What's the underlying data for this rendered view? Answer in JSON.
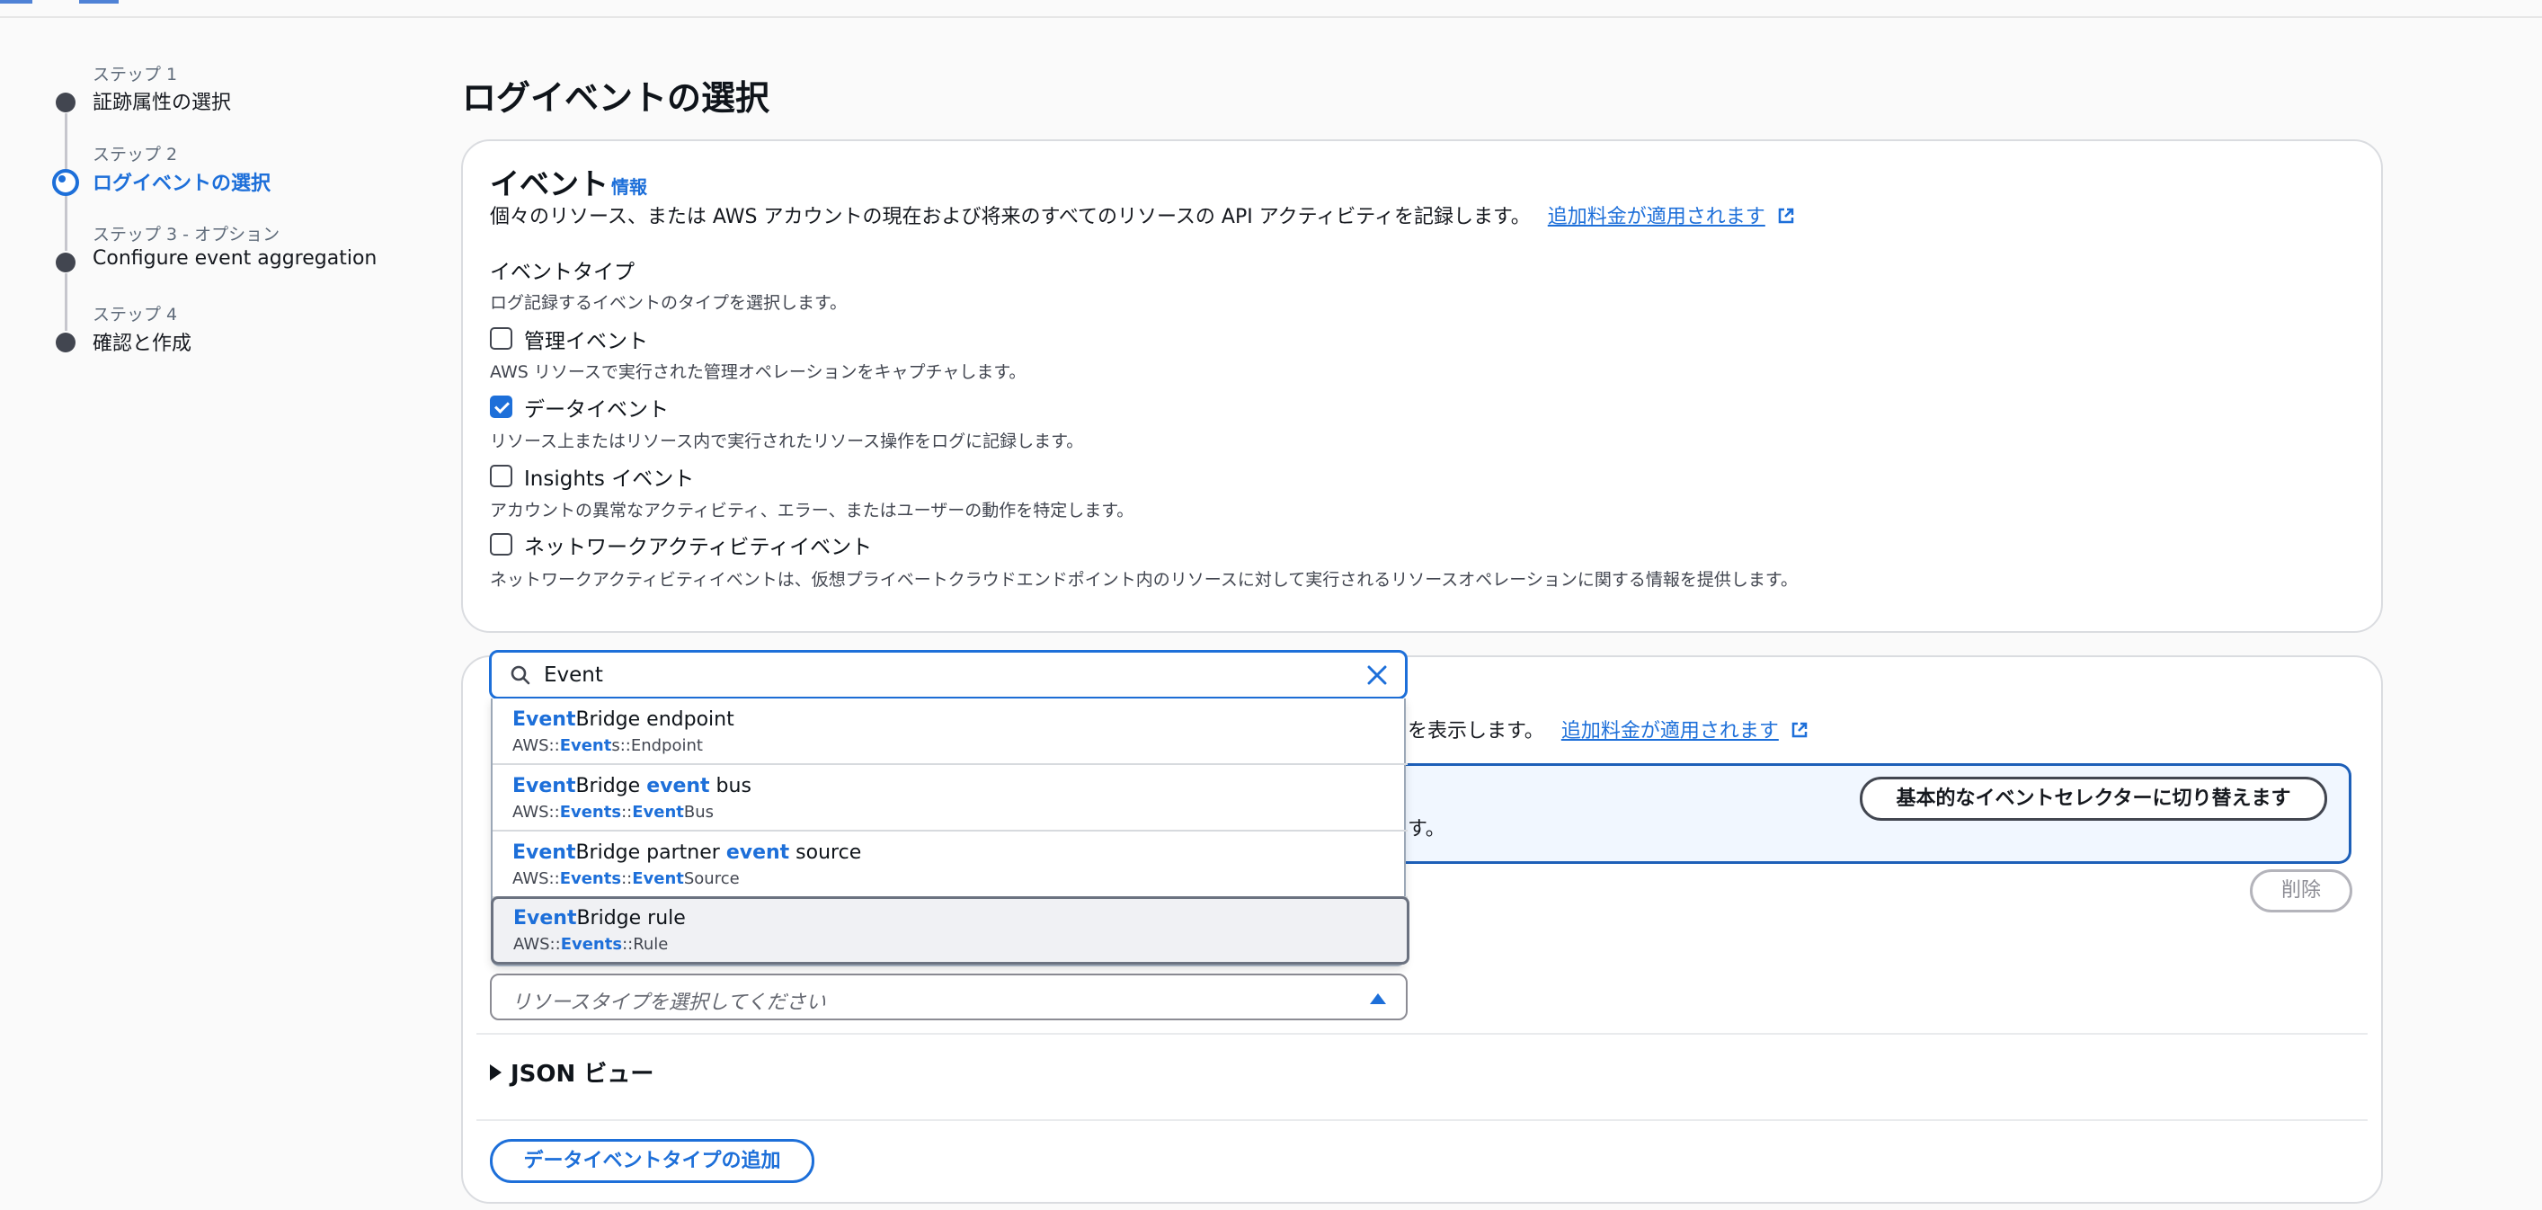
{
  "steps": [
    {
      "num": "ステップ 1",
      "title": "証跡属性の選択"
    },
    {
      "num": "ステップ 2",
      "title": "ログイベントの選択"
    },
    {
      "num": "ステップ 3 - オプション",
      "title": "Configure event aggregation"
    },
    {
      "num": "ステップ 4",
      "title": "確認と作成"
    }
  ],
  "active_step": 2,
  "page_title": "ログイベントの選択",
  "events_panel": {
    "heading": "イベント",
    "info_link": "情報",
    "description": "個々のリソース、または AWS アカウントの現在および将来のすべてのリソースの API アクティビティを記録します。",
    "pricing_link": "追加料金が適用されます",
    "event_type_label": "イベントタイプ",
    "event_type_hint": "ログ記録するイベントのタイプを選択します。",
    "options": [
      {
        "label": "管理イベント",
        "hint": "AWS リソースで実行された管理オペレーションをキャプチャします。",
        "checked": false
      },
      {
        "label": "データイベント",
        "hint": "リソース上またはリソース内で実行されたリソース操作をログに記録します。",
        "checked": true
      },
      {
        "label": "Insights イベント",
        "hint": "アカウントの異常なアクティビティ、エラー、またはユーザーの動作を特定します。",
        "checked": false
      },
      {
        "label": "ネットワークアクティビティイベント",
        "hint": "ネットワークアクティビティイベントは、仮想プライベートクラウドエンドポイント内のリソースに対して実行されるリソースオペレーションに関する情報を提供します。",
        "checked": false
      }
    ]
  },
  "data_events_panel": {
    "partial_description": "を表示します。",
    "pricing_link": "追加料金が適用されます",
    "info_partial": "す。",
    "switch_button": "基本的なイベントセレクターに切り替えます",
    "delete_button": "削除",
    "resource_type_placeholder": "リソースタイプを選択してください",
    "json_view": "JSON ビュー",
    "add_button": "データイベントタイプの追加"
  },
  "search": {
    "value": "Event",
    "results": [
      {
        "title_parts": [
          [
            "Event",
            true
          ],
          [
            "Bridge endpoint",
            false
          ]
        ],
        "sub_parts": [
          [
            "AWS::",
            false
          ],
          [
            "Event",
            true
          ],
          [
            "s::Endpoint",
            false
          ]
        ]
      },
      {
        "title_parts": [
          [
            "Event",
            true
          ],
          [
            "Bridge ",
            false
          ],
          [
            "event",
            true
          ],
          [
            " bus",
            false
          ]
        ],
        "sub_parts": [
          [
            "AWS::",
            false
          ],
          [
            "Events",
            true
          ],
          [
            "::",
            false
          ],
          [
            "Event",
            true
          ],
          [
            "Bus",
            false
          ]
        ]
      },
      {
        "title_parts": [
          [
            "Event",
            true
          ],
          [
            "Bridge partner ",
            false
          ],
          [
            "event",
            true
          ],
          [
            " source",
            false
          ]
        ],
        "sub_parts": [
          [
            "AWS::",
            false
          ],
          [
            "Events",
            true
          ],
          [
            "::",
            false
          ],
          [
            "Event",
            true
          ],
          [
            "Source",
            false
          ]
        ]
      },
      {
        "title_parts": [
          [
            "Event",
            true
          ],
          [
            "Bridge rule",
            false
          ]
        ],
        "sub_parts": [
          [
            "AWS::",
            false
          ],
          [
            "Events",
            true
          ],
          [
            "::Rule",
            false
          ]
        ]
      }
    ],
    "highlighted_index": 3
  },
  "colors": {
    "accent": "#1d6fd9",
    "text": "#0f141a",
    "muted": "#424650"
  }
}
